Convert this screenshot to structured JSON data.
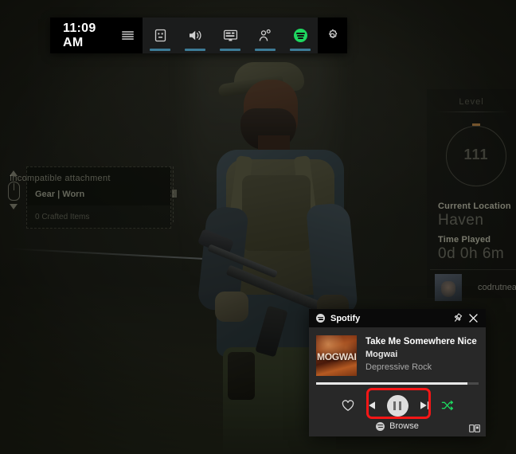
{
  "gamebar": {
    "clock": "11:09 AM",
    "menu_icon": "widget-menu-icon",
    "buttons": [
      {
        "name": "widget-store-icon",
        "label": "Widget store",
        "active": true
      },
      {
        "name": "audio-icon",
        "label": "Audio",
        "active": true
      },
      {
        "name": "capture-icon",
        "label": "Capture",
        "active": true
      },
      {
        "name": "social-icon",
        "label": "Xbox Social",
        "active": true
      },
      {
        "name": "spotify-icon",
        "label": "Spotify",
        "active": true
      },
      {
        "name": "gear-icon",
        "label": "Settings",
        "active": false
      }
    ],
    "accent_color": "#3d7b96",
    "spotify_green": "#1ed760"
  },
  "spotify_widget": {
    "title": "Spotify",
    "logo_icon": "spotify-logo-icon",
    "pin_icon": "pin-icon",
    "close_icon": "close-icon",
    "album_art_text": "MOGWAI",
    "song": "Take Me Somewhere Nice",
    "artist": "Mogwai",
    "genre": "Depressive Rock",
    "progress_percent": 93,
    "controls": {
      "like_icon": "heart-icon",
      "previous_icon": "previous-track-icon",
      "play_pause_icon": "pause-icon",
      "next_icon": "next-track-icon",
      "shuffle_icon": "shuffle-icon"
    },
    "browse_label": "Browse",
    "browse_icon": "spotify-browse-icon",
    "cast_icon": "cast-device-icon",
    "highlight_color": "#f61616"
  },
  "game_overlay": {
    "left_panel": {
      "title": "Incompatible attachment",
      "subtitle": "Gear | Worn",
      "footer": "0 Crafted Items",
      "mouse_icon": "mouse-scroll-icon"
    },
    "right_panel": {
      "level_label": "Level",
      "level_value": "111",
      "location_label": "Current Location",
      "location_value": "Haven",
      "time_label": "Time Played",
      "time_value": "0d 0h 6m",
      "gamertag": "codrutnea",
      "avatar": "player-avatar"
    }
  }
}
